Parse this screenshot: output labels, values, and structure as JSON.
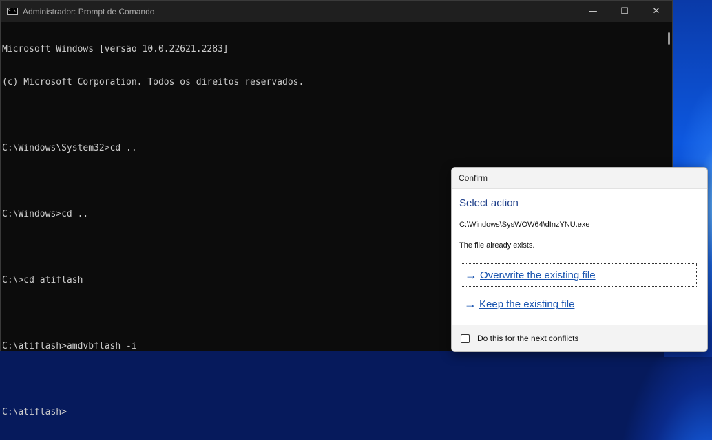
{
  "window": {
    "title": "Administrador: Prompt de Comando",
    "controls": {
      "minimize": "—",
      "maximize": "☐",
      "close": "✕"
    }
  },
  "console": {
    "lines": [
      "Microsoft Windows [versão 10.0.22621.2283]",
      "(c) Microsoft Corporation. Todos os direitos reservados.",
      "",
      "C:\\Windows\\System32>cd ..",
      "",
      "C:\\Windows>cd ..",
      "",
      "C:\\>cd atiflash",
      "",
      "C:\\atiflash>amdvbflash -i",
      "",
      "C:\\atiflash>"
    ]
  },
  "dialog": {
    "title": "Confirm",
    "heading": "Select action",
    "path": "C:\\Windows\\SysWOW64\\dInzYNU.exe",
    "message": "The file already exists.",
    "actions": [
      {
        "label": "Overwrite the existing file",
        "icon": "arrow-right-icon"
      },
      {
        "label": "Keep the existing file",
        "icon": "arrow-right-icon"
      }
    ],
    "checkbox_label": "Do this for the next conflicts",
    "checkbox_checked": false
  },
  "colors": {
    "console_bg": "#0c0c0c",
    "console_text": "#cccccc",
    "link_blue": "#1a55b0",
    "heading_blue": "#1e3f8a"
  }
}
